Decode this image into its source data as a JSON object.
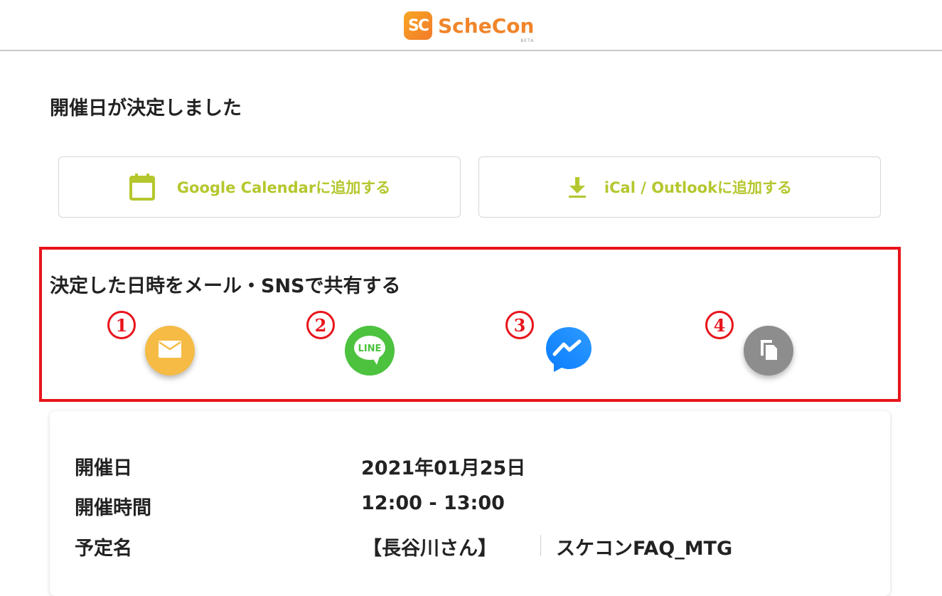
{
  "header": {
    "logo_mark": "SC",
    "logo_text": "ScheCon",
    "logo_sub": "BETA"
  },
  "main": {
    "title": "開催日が決定しました",
    "buttons": {
      "google": "Google Calendarに追加する",
      "ical": "iCal / Outlookに追加する"
    },
    "share": {
      "title": "決定した日時をメール・SNSで共有する",
      "markers": [
        "1",
        "2",
        "3",
        "4"
      ],
      "icons": [
        "mail-icon",
        "line-icon",
        "messenger-icon",
        "copy-icon"
      ]
    },
    "details": {
      "date_label": "開催日",
      "date_value": "2021年01月25日",
      "time_label": "開催時間",
      "time_value": "12:00 - 13:00",
      "name_label": "予定名",
      "name_part1": "【長谷川さん】",
      "name_part2": "スケコンFAQ_MTG"
    }
  },
  "colors": {
    "accent_green": "#b5c72e",
    "logo_orange": "#f0852a",
    "highlight_red": "#e8141c",
    "mail_yellow": "#f5bb45",
    "line_green": "#4cc23e",
    "messenger_blue": "#1877f2",
    "copy_gray": "#8d8d8d"
  }
}
